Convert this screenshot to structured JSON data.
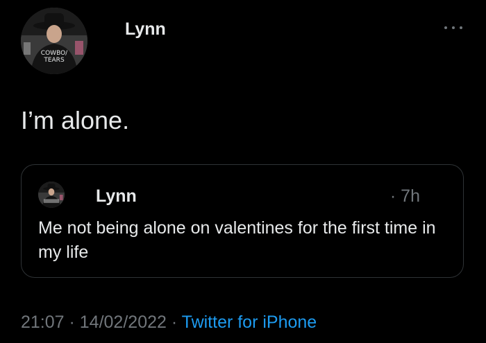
{
  "tweet": {
    "author_name": "Lynn",
    "avatar_shirt_text_line1": "COWBO/",
    "avatar_shirt_text_line2": "TEARS",
    "more_icon": "more-horizontal-icon",
    "text": "I’m alone.",
    "timestamp": "21:07 · 14/02/2022 ·",
    "source": "Twitter for iPhone"
  },
  "quoted_tweet": {
    "author_name": "Lynn",
    "time_ago": "· 7h",
    "text": "Me not being alone on valentines for the first time in my life"
  },
  "colors": {
    "background": "#000000",
    "primary_text": "#e7e9ea",
    "secondary_text": "#71767b",
    "link": "#1d9bf0",
    "border": "#2f3336"
  }
}
